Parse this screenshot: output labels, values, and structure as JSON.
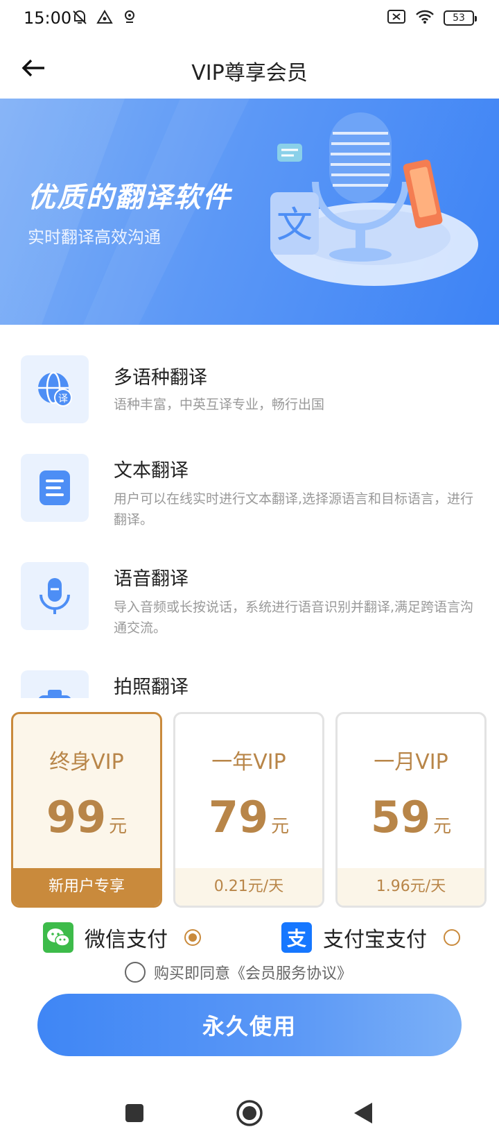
{
  "status_bar": {
    "time": "15:00",
    "battery": "53"
  },
  "header": {
    "title": "VIP尊享会员"
  },
  "banner": {
    "title": "优质的翻译软件",
    "subtitle": "实时翻译高效沟通"
  },
  "features": [
    {
      "title": "多语种翻译",
      "desc": "语种丰富，中英互译专业，畅行出国",
      "icon_badge": "译"
    },
    {
      "title": "文本翻译",
      "desc": "用户可以在线实时进行文本翻译,选择源语言和目标语言，进行翻译。"
    },
    {
      "title": "语音翻译",
      "desc": "导入音频或长按说话，系统进行语音识别并翻译,满足跨语言沟通交流。"
    },
    {
      "title": "拍照翻译"
    }
  ],
  "plans": [
    {
      "name": "终身VIP",
      "price": "99",
      "unit": "元",
      "note": "新用户专享",
      "selected": true
    },
    {
      "name": "一年VIP",
      "price": "79",
      "unit": "元",
      "note": "0.21元/天",
      "selected": false
    },
    {
      "name": "一月VIP",
      "price": "59",
      "unit": "元",
      "note": "1.96元/天",
      "selected": false
    }
  ],
  "payment": {
    "wechat_label": "微信支付",
    "alipay_label": "支付宝支付",
    "selected": "wechat",
    "alipay_glyph": "支"
  },
  "agreement": {
    "text": "购买即同意《会员服务协议》"
  },
  "buy_button": {
    "label": "永久使用"
  },
  "colors": {
    "accent_gold": "#c98a3c",
    "primary_blue": "#3f86f5"
  }
}
